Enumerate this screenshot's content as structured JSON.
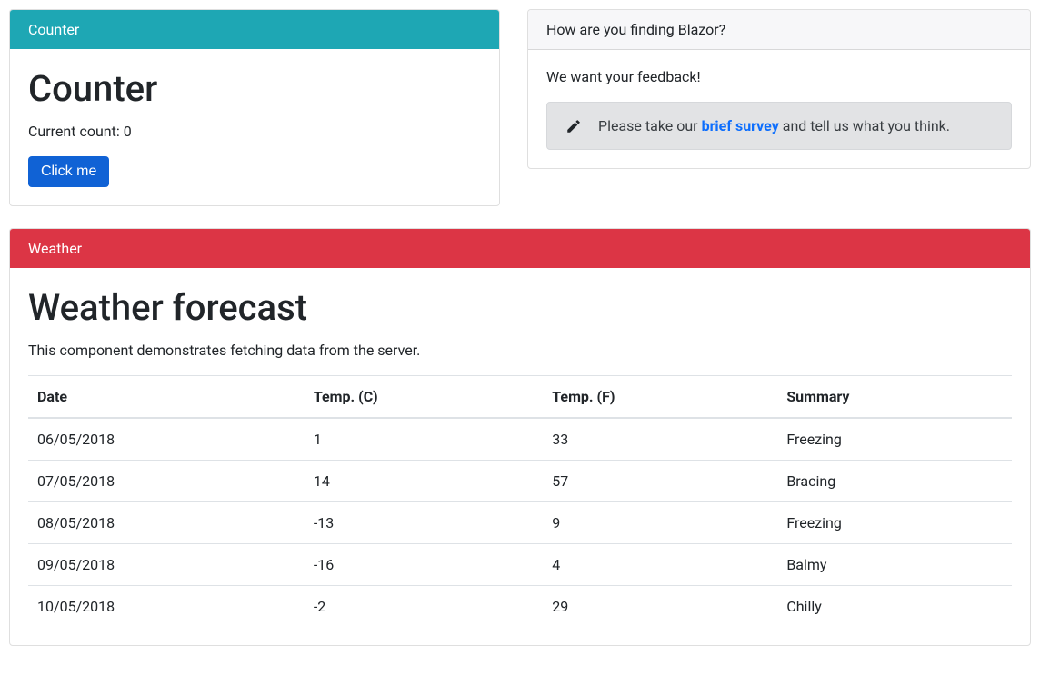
{
  "counter": {
    "header": "Counter",
    "title": "Counter",
    "countLabel": "Current count: 0",
    "buttonLabel": "Click me"
  },
  "feedback": {
    "header": "How are you finding Blazor?",
    "lead": "We want your feedback!",
    "alertPrefix": "Please take our ",
    "alertLink": "brief survey",
    "alertSuffix": " and tell us what you think."
  },
  "weather": {
    "header": "Weather",
    "title": "Weather forecast",
    "description": "This component demonstrates fetching data from the server.",
    "columns": [
      "Date",
      "Temp. (C)",
      "Temp. (F)",
      "Summary"
    ],
    "rows": [
      {
        "date": "06/05/2018",
        "tc": "1",
        "tf": "33",
        "summary": "Freezing"
      },
      {
        "date": "07/05/2018",
        "tc": "14",
        "tf": "57",
        "summary": "Bracing"
      },
      {
        "date": "08/05/2018",
        "tc": "-13",
        "tf": "9",
        "summary": "Freezing"
      },
      {
        "date": "09/05/2018",
        "tc": "-16",
        "tf": "4",
        "summary": "Balmy"
      },
      {
        "date": "10/05/2018",
        "tc": "-2",
        "tf": "29",
        "summary": "Chilly"
      }
    ]
  }
}
